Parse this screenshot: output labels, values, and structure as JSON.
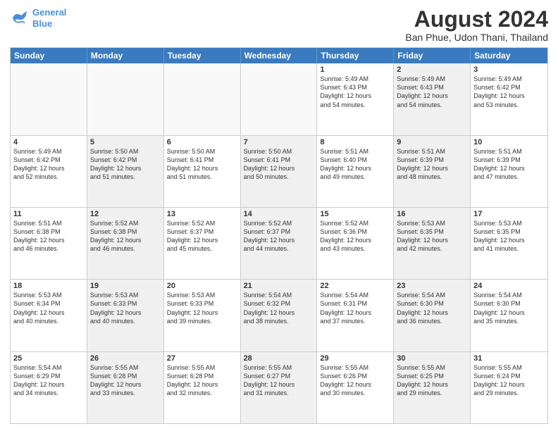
{
  "logo": {
    "line1": "General",
    "line2": "Blue"
  },
  "title": "August 2024",
  "location": "Ban Phue, Udon Thani, Thailand",
  "days_of_week": [
    "Sunday",
    "Monday",
    "Tuesday",
    "Wednesday",
    "Thursday",
    "Friday",
    "Saturday"
  ],
  "weeks": [
    [
      {
        "day": "",
        "info": "",
        "shaded": false,
        "empty": true
      },
      {
        "day": "",
        "info": "",
        "shaded": false,
        "empty": true
      },
      {
        "day": "",
        "info": "",
        "shaded": false,
        "empty": true
      },
      {
        "day": "",
        "info": "",
        "shaded": false,
        "empty": true
      },
      {
        "day": "1",
        "info": "Sunrise: 5:49 AM\nSunset: 6:43 PM\nDaylight: 12 hours\nand 54 minutes.",
        "shaded": false,
        "empty": false
      },
      {
        "day": "2",
        "info": "Sunrise: 5:49 AM\nSunset: 6:43 PM\nDaylight: 12 hours\nand 54 minutes.",
        "shaded": true,
        "empty": false
      },
      {
        "day": "3",
        "info": "Sunrise: 5:49 AM\nSunset: 6:42 PM\nDaylight: 12 hours\nand 53 minutes.",
        "shaded": false,
        "empty": false
      }
    ],
    [
      {
        "day": "4",
        "info": "Sunrise: 5:49 AM\nSunset: 6:42 PM\nDaylight: 12 hours\nand 52 minutes.",
        "shaded": false,
        "empty": false
      },
      {
        "day": "5",
        "info": "Sunrise: 5:50 AM\nSunset: 6:42 PM\nDaylight: 12 hours\nand 51 minutes.",
        "shaded": true,
        "empty": false
      },
      {
        "day": "6",
        "info": "Sunrise: 5:50 AM\nSunset: 6:41 PM\nDaylight: 12 hours\nand 51 minutes.",
        "shaded": false,
        "empty": false
      },
      {
        "day": "7",
        "info": "Sunrise: 5:50 AM\nSunset: 6:41 PM\nDaylight: 12 hours\nand 50 minutes.",
        "shaded": true,
        "empty": false
      },
      {
        "day": "8",
        "info": "Sunrise: 5:51 AM\nSunset: 6:40 PM\nDaylight: 12 hours\nand 49 minutes.",
        "shaded": false,
        "empty": false
      },
      {
        "day": "9",
        "info": "Sunrise: 5:51 AM\nSunset: 6:39 PM\nDaylight: 12 hours\nand 48 minutes.",
        "shaded": true,
        "empty": false
      },
      {
        "day": "10",
        "info": "Sunrise: 5:51 AM\nSunset: 6:39 PM\nDaylight: 12 hours\nand 47 minutes.",
        "shaded": false,
        "empty": false
      }
    ],
    [
      {
        "day": "11",
        "info": "Sunrise: 5:51 AM\nSunset: 6:38 PM\nDaylight: 12 hours\nand 46 minutes.",
        "shaded": false,
        "empty": false
      },
      {
        "day": "12",
        "info": "Sunrise: 5:52 AM\nSunset: 6:38 PM\nDaylight: 12 hours\nand 46 minutes.",
        "shaded": true,
        "empty": false
      },
      {
        "day": "13",
        "info": "Sunrise: 5:52 AM\nSunset: 6:37 PM\nDaylight: 12 hours\nand 45 minutes.",
        "shaded": false,
        "empty": false
      },
      {
        "day": "14",
        "info": "Sunrise: 5:52 AM\nSunset: 6:37 PM\nDaylight: 12 hours\nand 44 minutes.",
        "shaded": true,
        "empty": false
      },
      {
        "day": "15",
        "info": "Sunrise: 5:52 AM\nSunset: 6:36 PM\nDaylight: 12 hours\nand 43 minutes.",
        "shaded": false,
        "empty": false
      },
      {
        "day": "16",
        "info": "Sunrise: 5:53 AM\nSunset: 6:35 PM\nDaylight: 12 hours\nand 42 minutes.",
        "shaded": true,
        "empty": false
      },
      {
        "day": "17",
        "info": "Sunrise: 5:53 AM\nSunset: 6:35 PM\nDaylight: 12 hours\nand 41 minutes.",
        "shaded": false,
        "empty": false
      }
    ],
    [
      {
        "day": "18",
        "info": "Sunrise: 5:53 AM\nSunset: 6:34 PM\nDaylight: 12 hours\nand 40 minutes.",
        "shaded": false,
        "empty": false
      },
      {
        "day": "19",
        "info": "Sunrise: 5:53 AM\nSunset: 6:33 PM\nDaylight: 12 hours\nand 40 minutes.",
        "shaded": true,
        "empty": false
      },
      {
        "day": "20",
        "info": "Sunrise: 5:53 AM\nSunset: 6:33 PM\nDaylight: 12 hours\nand 39 minutes.",
        "shaded": false,
        "empty": false
      },
      {
        "day": "21",
        "info": "Sunrise: 5:54 AM\nSunset: 6:32 PM\nDaylight: 12 hours\nand 38 minutes.",
        "shaded": true,
        "empty": false
      },
      {
        "day": "22",
        "info": "Sunrise: 5:54 AM\nSunset: 6:31 PM\nDaylight: 12 hours\nand 37 minutes.",
        "shaded": false,
        "empty": false
      },
      {
        "day": "23",
        "info": "Sunrise: 5:54 AM\nSunset: 6:30 PM\nDaylight: 12 hours\nand 36 minutes.",
        "shaded": true,
        "empty": false
      },
      {
        "day": "24",
        "info": "Sunrise: 5:54 AM\nSunset: 6:30 PM\nDaylight: 12 hours\nand 35 minutes.",
        "shaded": false,
        "empty": false
      }
    ],
    [
      {
        "day": "25",
        "info": "Sunrise: 5:54 AM\nSunset: 6:29 PM\nDaylight: 12 hours\nand 34 minutes.",
        "shaded": false,
        "empty": false
      },
      {
        "day": "26",
        "info": "Sunrise: 5:55 AM\nSunset: 6:28 PM\nDaylight: 12 hours\nand 33 minutes.",
        "shaded": true,
        "empty": false
      },
      {
        "day": "27",
        "info": "Sunrise: 5:55 AM\nSunset: 6:28 PM\nDaylight: 12 hours\nand 32 minutes.",
        "shaded": false,
        "empty": false
      },
      {
        "day": "28",
        "info": "Sunrise: 5:55 AM\nSunset: 6:27 PM\nDaylight: 12 hours\nand 31 minutes.",
        "shaded": true,
        "empty": false
      },
      {
        "day": "29",
        "info": "Sunrise: 5:55 AM\nSunset: 6:26 PM\nDaylight: 12 hours\nand 30 minutes.",
        "shaded": false,
        "empty": false
      },
      {
        "day": "30",
        "info": "Sunrise: 5:55 AM\nSunset: 6:25 PM\nDaylight: 12 hours\nand 29 minutes.",
        "shaded": true,
        "empty": false
      },
      {
        "day": "31",
        "info": "Sunrise: 5:55 AM\nSunset: 6:24 PM\nDaylight: 12 hours\nand 29 minutes.",
        "shaded": false,
        "empty": false
      }
    ]
  ]
}
